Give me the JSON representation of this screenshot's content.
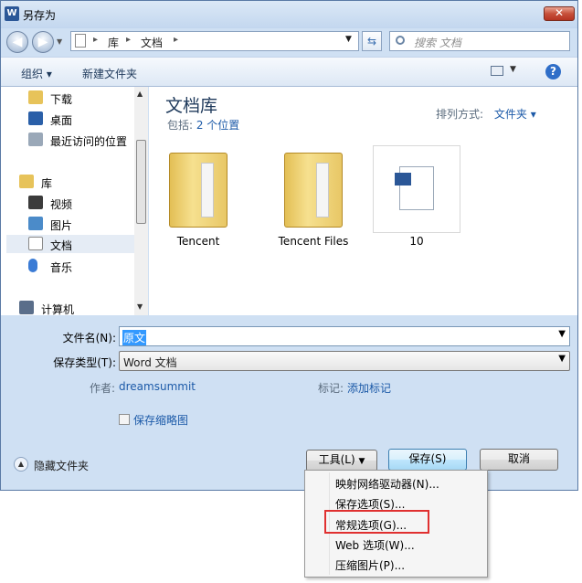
{
  "window": {
    "title": "另存为",
    "app_icon_glyph": "W"
  },
  "address": {
    "crumbs": [
      "库",
      "文档"
    ],
    "separator": "▸",
    "search_placeholder": "搜索 文档"
  },
  "toolbar": {
    "organize": "组织 ▾",
    "new_folder": "新建文件夹"
  },
  "nav": {
    "items": [
      {
        "label": "下载",
        "icon": "download-folder-icon"
      },
      {
        "label": "桌面",
        "icon": "desktop-icon"
      },
      {
        "label": "最近访问的位置",
        "icon": "recent-places-icon"
      },
      {
        "label": "库",
        "icon": "library-icon"
      },
      {
        "label": "视频",
        "icon": "video-icon"
      },
      {
        "label": "图片",
        "icon": "pictures-icon"
      },
      {
        "label": "文档",
        "icon": "documents-icon"
      },
      {
        "label": "音乐",
        "icon": "music-icon"
      },
      {
        "label": "计算机",
        "icon": "computer-icon"
      }
    ]
  },
  "content": {
    "title": "文档库",
    "includes_prefix": "包括: ",
    "includes_link": "2 个位置",
    "sort_label": "排列方式:",
    "sort_value": "文件夹 ▾",
    "files": [
      {
        "name": "Tencent",
        "icon": "folder-icon"
      },
      {
        "name": "Tencent Files",
        "icon": "folder-icon"
      },
      {
        "name": "10",
        "icon": "word-document-icon"
      }
    ]
  },
  "form": {
    "filename_label": "文件名(N):",
    "filename_value": "原文",
    "filetype_label": "保存类型(T):",
    "filetype_value": "Word 文档",
    "author_label": "作者:",
    "author_value": "dreamsummit",
    "tags_label": "标记:",
    "tags_value": "添加标记",
    "thumbnail_label": "保存缩略图"
  },
  "footer": {
    "hide_folders": "隐藏文件夹",
    "tools": "工具(L)",
    "save": "保存(S)",
    "cancel": "取消"
  },
  "tools_menu": {
    "items": [
      "映射网络驱动器(N)...",
      "保存选项(S)...",
      "常规选项(G)...",
      "Web 选项(W)...",
      "压缩图片(P)..."
    ],
    "highlighted_index": 2
  },
  "colors": {
    "accent": "#1c5aa8",
    "highlight_box": "#e03030",
    "selection": "#3399ff"
  }
}
